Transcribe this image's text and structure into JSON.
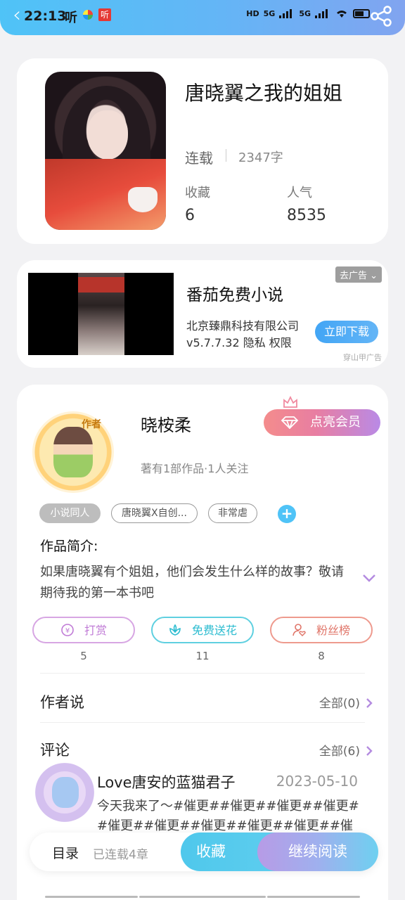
{
  "status_bar": {
    "time": "22:13",
    "app_label": "听",
    "app_badge": "听",
    "network_1": "5G",
    "network_2": "5G",
    "hd": "HD"
  },
  "book": {
    "title": "唐晓翼之我的姐姐",
    "status": "连载",
    "word_count": "2347字",
    "collect_label": "收藏",
    "collect_value": "6",
    "popularity_label": "人气",
    "popularity_value": "8535"
  },
  "ad": {
    "title": "番茄免费小说",
    "company": "北京臻鼎科技有限公司",
    "meta": "v5.7.7.32  隐私  权限",
    "close_label": "去广告",
    "download_label": "立即下载",
    "source": "穿山甲广告"
  },
  "author": {
    "badge": "作者",
    "name": "晓桉柔",
    "info": "著有1部作品·1人关注",
    "vip_label": "点亮会员"
  },
  "tags": [
    "小说同人",
    "唐晓翼X自创...",
    "非常虐"
  ],
  "intro": {
    "label": "作品简介:",
    "text": "如果唐晓翼有个姐姐，他们会发生什么样的故事？敬请期待我的第一本书吧"
  },
  "actions": [
    {
      "label": "打赏",
      "count": "5",
      "icon": "coin-icon"
    },
    {
      "label": "免费送花",
      "count": "11",
      "icon": "flower-icon"
    },
    {
      "label": "粉丝榜",
      "count": "8",
      "icon": "user-heart-icon"
    }
  ],
  "author_says": {
    "title": "作者说",
    "more": "全部(0)"
  },
  "comments": {
    "title": "评论",
    "more": "全部(6)",
    "items": [
      {
        "user": "Love唐安的蓝猫君子",
        "date": "2023-05-10",
        "text": "今天我来了～#催更##催更##催更##催更##催更##催更##催更##催更##催更##催更##"
      }
    ]
  },
  "bottom_bar": {
    "toc": "目录",
    "progress": "已连载4章",
    "collect": "收藏",
    "read": "继续阅读"
  },
  "colors": {
    "accent_blue": "#4fc3f7",
    "accent_purple": "#b79be6",
    "tip_color": "#c07bd6",
    "flower_color": "#2cbcd0",
    "fans_color": "#e0766a"
  }
}
